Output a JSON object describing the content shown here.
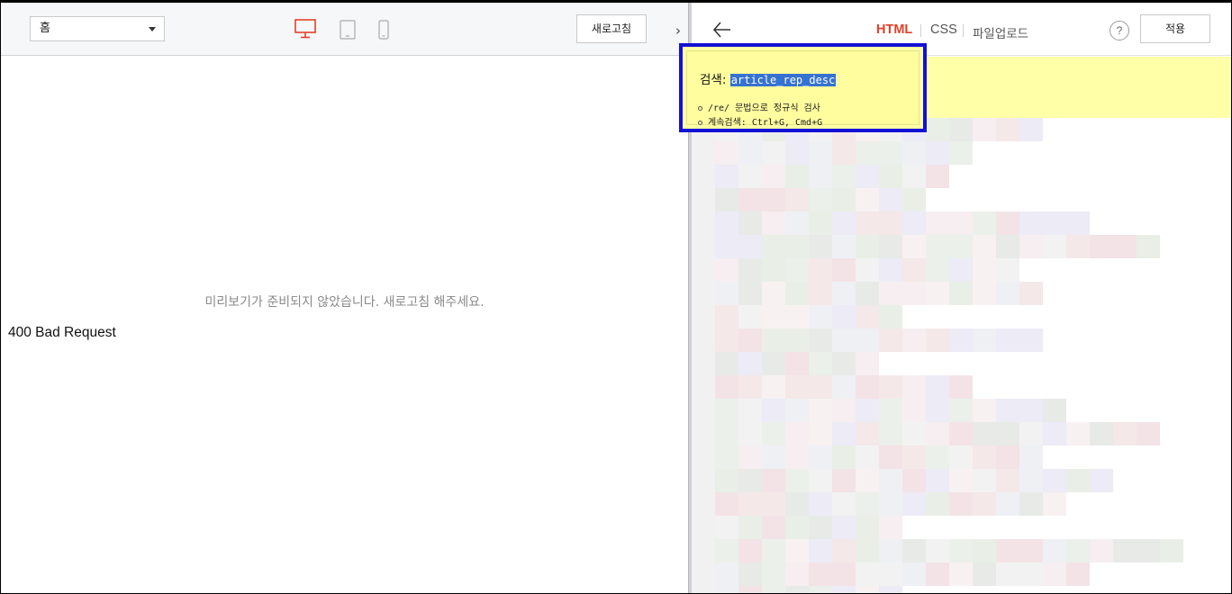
{
  "left_toolbar": {
    "page_select": "홈",
    "refresh_label": "새로고침",
    "collapse_glyph": "›"
  },
  "preview": {
    "message": "미리보기가 준비되지 않았습니다. 새로고침 해주세요.",
    "error": "400 Bad Request"
  },
  "right_toolbar": {
    "back_glyph": "←",
    "tabs": [
      {
        "label": "HTML"
      },
      {
        "label": "CSS"
      },
      {
        "label": "파일업로드"
      }
    ],
    "help_label": "?",
    "apply_label": "적용"
  },
  "search": {
    "label": "검색:",
    "query": "article_rep_desc",
    "hints": [
      "/re/ 문법으로 정규식 검사",
      "계속검색: Ctrl+G, Cmd+G"
    ]
  },
  "colors": {
    "accent": "#e2412b",
    "search_bg": "#ffffa8",
    "highlight_border": "#1410d6",
    "selection": "#3572d1"
  }
}
